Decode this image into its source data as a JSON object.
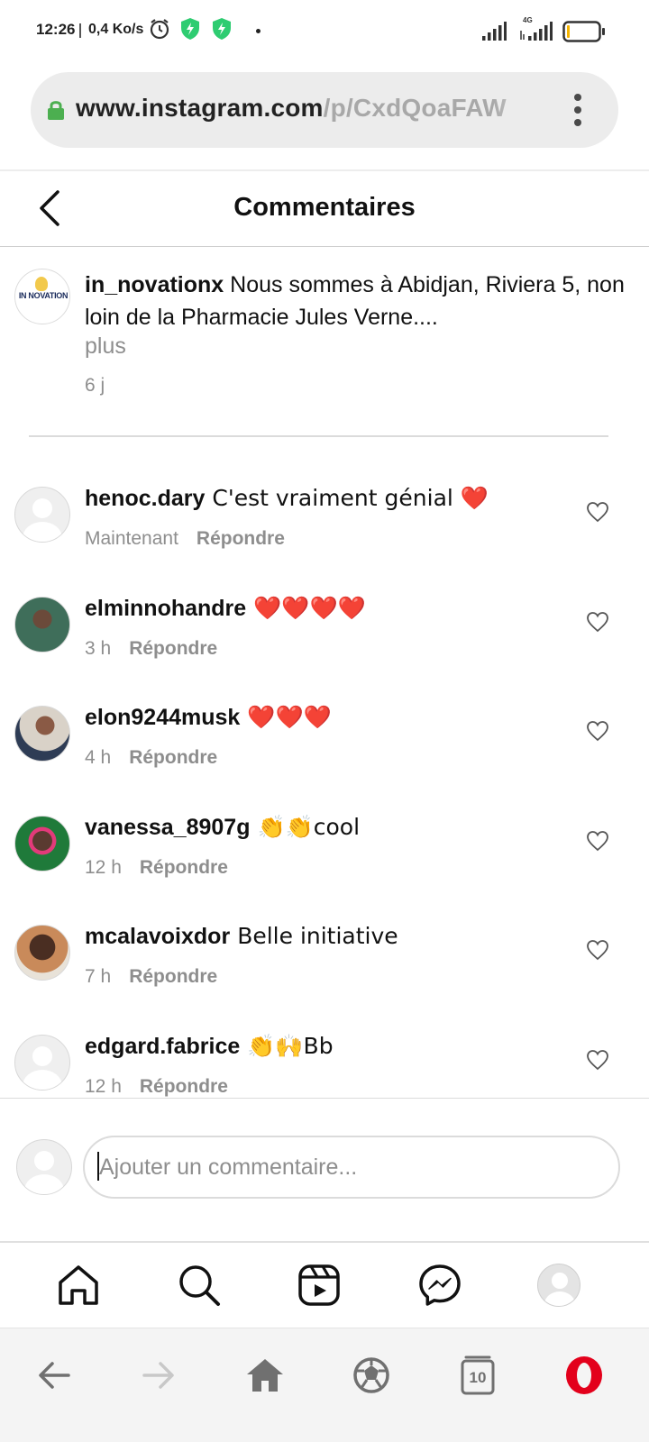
{
  "status_bar": {
    "time": "12:26",
    "speed": "0,4 Ko/s",
    "network": "4G"
  },
  "browser": {
    "url_host": "www.instagram.com",
    "url_path": "/p/CxdQoaFAW",
    "tab_count": "10"
  },
  "header": {
    "title": "Commentaires"
  },
  "caption": {
    "username": "in_novationx",
    "text": "Nous sommes à Abidjan, Riviera 5, non loin de la Pharmacie Jules Verne....",
    "more": "plus",
    "time": "6 j",
    "logo_text": "IN NOVATION"
  },
  "comments": [
    {
      "username": "henoc.dary",
      "text": "C'est vraiment génial ❤️",
      "time": "Maintenant",
      "reply": "Répondre",
      "avatar": "default"
    },
    {
      "username": "elminnohandre",
      "text": "❤️❤️❤️❤️",
      "time": "3 h",
      "reply": "Répondre",
      "avatar": "photo"
    },
    {
      "username": "elon9244musk",
      "text": "❤️❤️❤️",
      "time": "4 h",
      "reply": "Répondre",
      "avatar": "photo"
    },
    {
      "username": "vanessa_8907g",
      "text": "👏👏cool",
      "time": "12 h",
      "reply": "Répondre",
      "avatar": "photo"
    },
    {
      "username": "mcalavoixdor",
      "text": "Belle initiative",
      "time": "7 h",
      "reply": "Répondre",
      "avatar": "photo"
    },
    {
      "username": "edgard.fabrice",
      "text": "👏🙌Bb",
      "time": "12 h",
      "reply": "Répondre",
      "avatar": "default"
    }
  ],
  "comment_input": {
    "placeholder": "Ajouter un commentaire..."
  },
  "colors": {
    "heart_red": "#e8102e",
    "muted_text": "#8e8e8e",
    "opera_red": "#e3001b",
    "lock_green": "#4caf50",
    "shield_green": "#2ecc71"
  },
  "icons": {
    "ig_nav": [
      "home-icon",
      "search-icon",
      "reels-icon",
      "messenger-icon",
      "profile-avatar"
    ],
    "browser_bar": [
      "back-arrow-icon",
      "forward-arrow-icon",
      "home-icon",
      "speed-dial-icon",
      "tabs-icon",
      "opera-logo-icon"
    ]
  }
}
